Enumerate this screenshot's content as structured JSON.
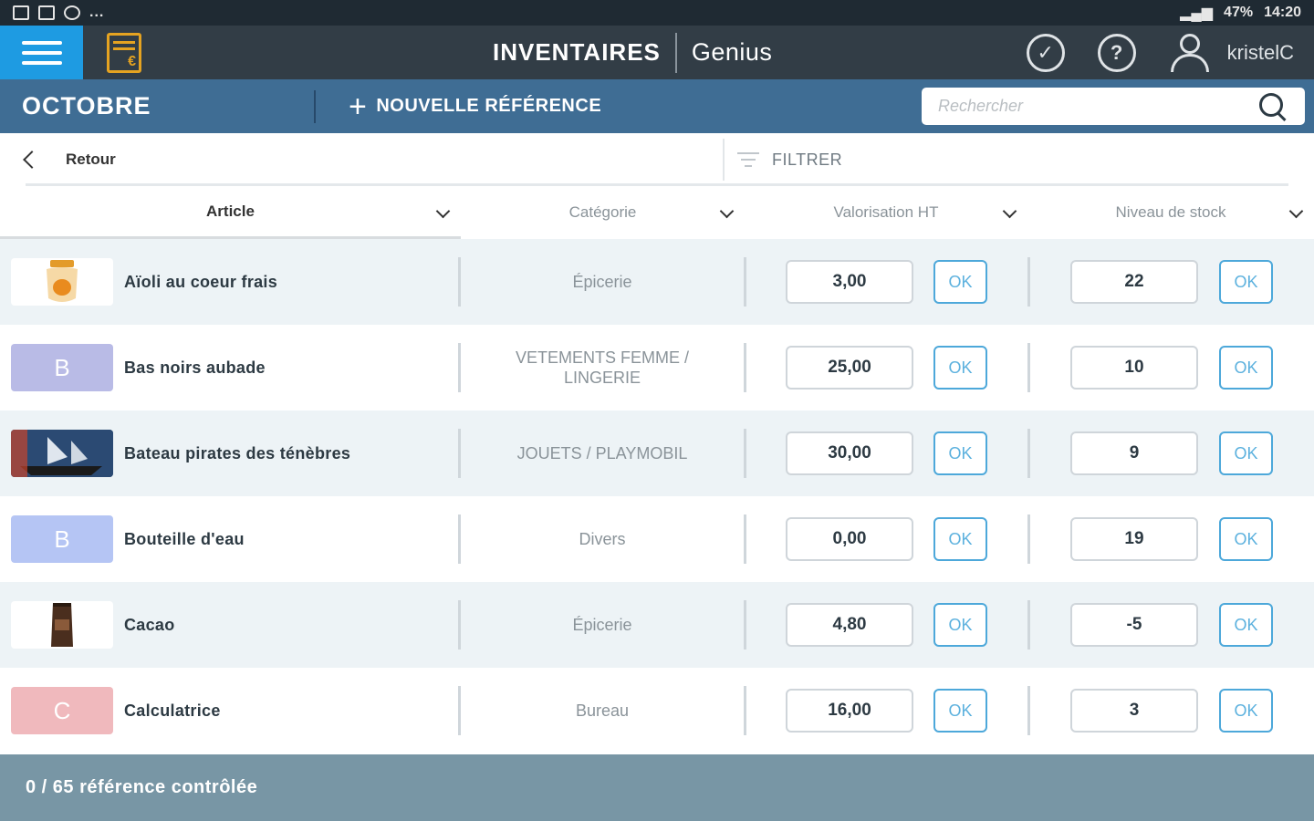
{
  "status_bar": {
    "left_dots": "...",
    "battery": "47%",
    "time": "14:20"
  },
  "app_bar": {
    "title": "INVENTAIRES",
    "brand": "Genius",
    "user": "kristelC",
    "icons": [
      "menu-icon",
      "cash-register-icon",
      "check-circle-icon",
      "help-icon",
      "user-icon"
    ]
  },
  "sub_bar": {
    "month": "OCTOBRE",
    "new_reference": "NOUVELLE RÉFÉRENCE",
    "search_placeholder": "Rechercher"
  },
  "filter_row": {
    "back": "Retour",
    "filter": "FILTRER"
  },
  "columns": [
    "Article",
    "Catégorie",
    "Valorisation HT",
    "Niveau de stock"
  ],
  "ok_label": "OK",
  "rows": [
    {
      "name": "Aïoli au coeur frais",
      "category": "Épicerie",
      "valuation": "3,00",
      "stock": "22",
      "thumb_type": "image",
      "thumb_letter": "",
      "thumb_color": "#ffffff"
    },
    {
      "name": "Bas noirs aubade",
      "category": "VETEMENTS FEMME / LINGERIE",
      "valuation": "25,00",
      "stock": "10",
      "thumb_type": "letter",
      "thumb_letter": "B",
      "thumb_color": "#b9bbe6"
    },
    {
      "name": "Bateau pirates des ténèbres",
      "category": "JOUETS / PLAYMOBIL",
      "valuation": "30,00",
      "stock": "9",
      "thumb_type": "image",
      "thumb_letter": "",
      "thumb_color": "#2b4a73"
    },
    {
      "name": "Bouteille d'eau",
      "category": "Divers",
      "valuation": "0,00",
      "stock": "19",
      "thumb_type": "letter",
      "thumb_letter": "B",
      "thumb_color": "#b5c5f4"
    },
    {
      "name": "Cacao",
      "category": "Épicerie",
      "valuation": "4,80",
      "stock": "-5",
      "thumb_type": "image",
      "thumb_letter": "",
      "thumb_color": "#ffffff"
    },
    {
      "name": "Calculatrice",
      "category": "Bureau",
      "valuation": "16,00",
      "stock": "3",
      "thumb_type": "letter",
      "thumb_letter": "C",
      "thumb_color": "#f0b9bd"
    }
  ],
  "footer": {
    "text": "0 / 65 référence contrôlée"
  }
}
